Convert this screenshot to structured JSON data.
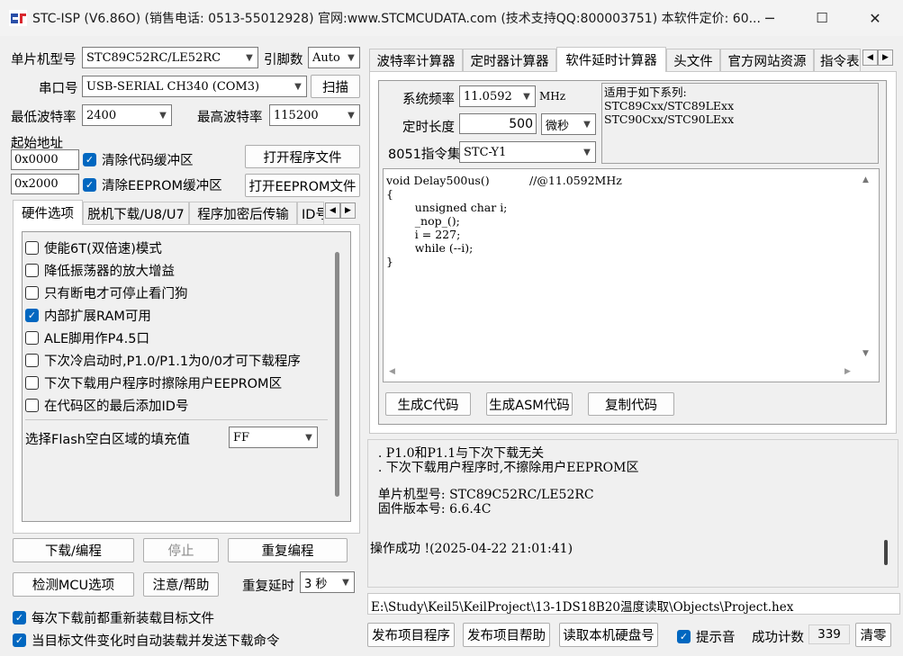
{
  "window": {
    "title": "STC-ISP (V6.86O) (销售电话: 0513-55012928) 官网:www.STCMCUDATA.com  (技术支持QQ:800003751) 本软件定价: 60...",
    "minimize": "─",
    "maximize": "☐",
    "close": "✕"
  },
  "mcu": {
    "label": "单片机型号",
    "value": "STC89C52RC/LE52RC",
    "pins_label": "引脚数",
    "pins_value": "Auto"
  },
  "port": {
    "label": "串口号",
    "value": "USB-SERIAL CH340 (COM3)",
    "scan": "扫描"
  },
  "baud": {
    "min_label": "最低波特率",
    "min_value": "2400",
    "max_label": "最高波特率",
    "max_value": "115200"
  },
  "start_addr": {
    "label": "起始地址",
    "code_addr": "0x0000",
    "clear_code": "清除代码缓冲区",
    "open_program": "打开程序文件",
    "eeprom_addr": "0x2000",
    "clear_eeprom": "清除EEPROM缓冲区",
    "open_eeprom": "打开EEPROM文件"
  },
  "left_tabs": [
    "硬件选项",
    "脱机下载/U8/U7",
    "程序加密后传输",
    "ID号"
  ],
  "hw_options": [
    {
      "label": "使能6T(双倍速)模式",
      "checked": false
    },
    {
      "label": "降低振荡器的放大增益",
      "checked": false
    },
    {
      "label": "只有断电才可停止看门狗",
      "checked": false
    },
    {
      "label": "内部扩展RAM可用",
      "checked": true
    },
    {
      "label": "ALE脚用作P4.5口",
      "checked": false
    },
    {
      "label": "下次冷启动时,P1.0/P1.1为0/0才可下载程序",
      "checked": false
    },
    {
      "label": "下次下载用户程序时擦除用户EEPROM区",
      "checked": false
    },
    {
      "label": "在代码区的最后添加ID号",
      "checked": false
    }
  ],
  "fill": {
    "label": "选择Flash空白区域的填充值",
    "value": "FF"
  },
  "actions": {
    "download": "下载/编程",
    "stop": "停止",
    "repeat": "重复编程",
    "check_mcu": "检测MCU选项",
    "help": "注意/帮助",
    "repeat_delay_label": "重复延时",
    "repeat_delay_value": "3 秒"
  },
  "bottom_checks": [
    {
      "label": "每次下载前都重新装载目标文件",
      "checked": true
    },
    {
      "label": "当目标文件变化时自动装载并发送下载命令",
      "checked": true
    }
  ],
  "right_tabs": [
    "波特率计算器",
    "定时器计算器",
    "软件延时计算器",
    "头文件",
    "官方网站资源",
    "指令表"
  ],
  "delay": {
    "freq_label": "系统频率",
    "freq_value": "11.0592",
    "freq_unit": "MHz",
    "len_label": "定时长度",
    "len_value": "500",
    "len_unit": "微秒",
    "isa_label": "8051指令集",
    "isa_value": "STC-Y1",
    "series_title": "适用于如下系列:",
    "series": [
      "STC89Cxx/STC89LExx",
      "STC90Cxx/STC90LExx"
    ],
    "code_lines": [
      "void Delay500us()\t\t//@11.0592MHz",
      "{",
      "\tunsigned char i;",
      "",
      "\t_nop_();",
      "\ti = 227;",
      "\twhile (--i);",
      "}"
    ],
    "gen_c": "生成C代码",
    "gen_asm": "生成ASM代码",
    "copy": "复制代码"
  },
  "log": {
    "lines": [
      "  . P1.0和P1.1与下次下载无关",
      "  . 下次下载用户程序时,不擦除用户EEPROM区",
      "",
      "  单片机型号: STC89C52RC/LE52RC",
      "  固件版本号: 6.6.4C",
      "",
      "",
      "操作成功 !(2025-04-22 21:01:41)"
    ]
  },
  "file_path": "E:\\Study\\Keil5\\KeilProject\\13-1DS18B20温度读取\\Objects\\Project.hex",
  "footer": {
    "publish_program": "发布项目程序",
    "publish_help": "发布项目帮助",
    "read_hdd": "读取本机硬盘号",
    "sound": "提示音",
    "sound_checked": true,
    "success_label": "成功计数",
    "success_value": "339",
    "clear": "清零"
  },
  "colors": {
    "accent": "#0067c0",
    "logo_blue": "#2b4fa8",
    "logo_red": "#d9272e"
  }
}
